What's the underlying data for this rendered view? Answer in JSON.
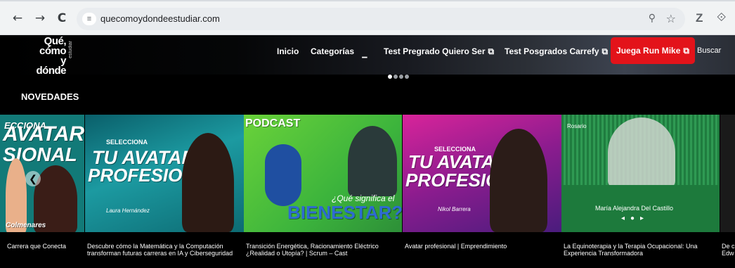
{
  "browser": {
    "url": "quecomoydondeestudiar.com",
    "back_icon": "←",
    "forward_icon": "→",
    "reload_icon": "C",
    "site_info_icon": "≡",
    "zoom_icon": "⚲",
    "star_icon": "☆",
    "extension_icon_1": "Z",
    "extension_icon_2": "⟐"
  },
  "header": {
    "logo_lines": [
      "Qué,",
      "cómo y",
      "dónde"
    ],
    "logo_sub": "estudiar",
    "nav": {
      "inicio": "Inicio",
      "categorias": "Categorías",
      "test_pregrado": "Test Pregrado Quiero Ser",
      "test_posgrados": "Test Posgrados Carrefy"
    },
    "cta_label": "Juega Run Mike",
    "search_label": "Buscar",
    "colors": {
      "cta": "#e3131a",
      "header_bg": "#000000"
    }
  },
  "novedades": {
    "title": "NOVEDADES",
    "cards": [
      {
        "image_text": [
          "ECCIONA",
          "AVATAR",
          "SIONAL",
          "Colmenares"
        ],
        "caption": "Carrera que Conecta"
      },
      {
        "image_text": [
          "SELECCIONA",
          "TU AVATAR",
          "PROFESIONAL",
          "Laura Hernández"
        ],
        "caption": "Descubre cómo la Matemática y la Computación transforman futuras carreras en IA y Ciberseguridad"
      },
      {
        "image_text": [
          "PODCAST",
          "¿Qué significa el",
          "BIENESTAR?"
        ],
        "caption": "Transición Energética, Racionamiento Eléctrico ¿Realidad o Utopía? | Scrum – Cast"
      },
      {
        "image_text": [
          "SELECCIONA",
          "TU AVATAR",
          "PROFESIONAL",
          "Nikol Barrera"
        ],
        "caption": "Avatar profesional | Emprendimiento"
      },
      {
        "image_text": [
          "Rosario",
          "María Alejandra Del Castillo"
        ],
        "caption": "La Equinoterapia y la Terapia Ocupacional: Una Experiencia Transformadora"
      },
      {
        "image_text": [],
        "caption": "De c Edw"
      }
    ]
  }
}
